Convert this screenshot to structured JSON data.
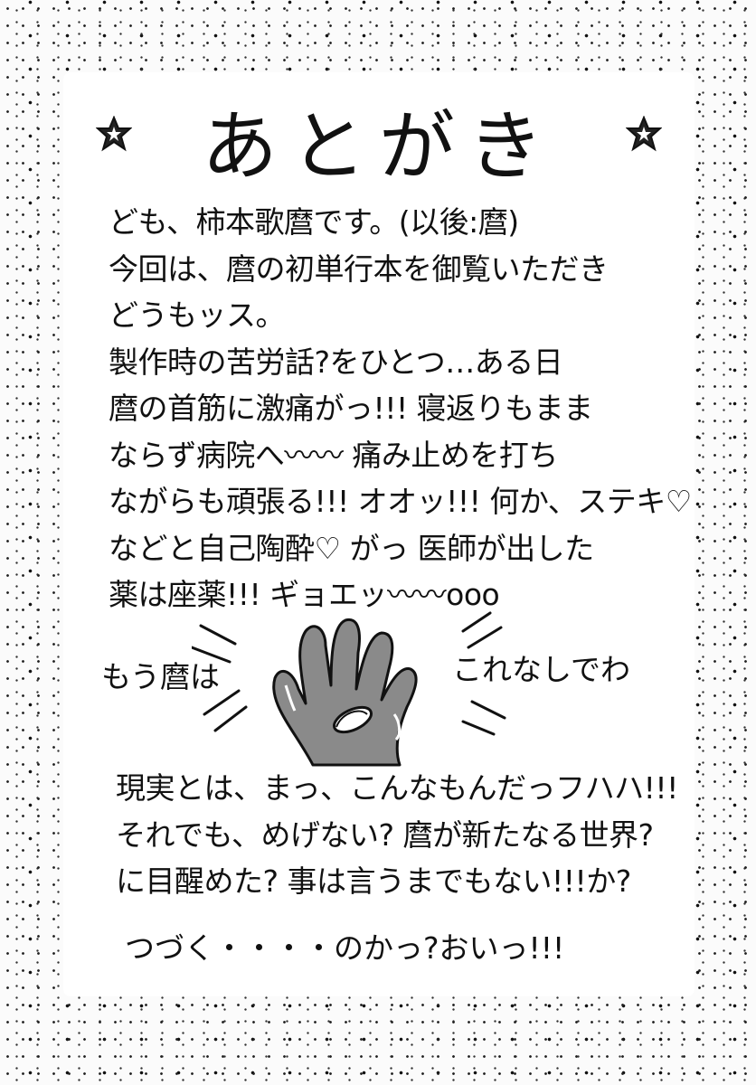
{
  "title": "あとがき",
  "body_lines": [
    "ども、柿本歌麿です。(以後:麿)",
    "今回は、麿の初単行本を御覧いただき",
    "どうもッス。",
    "製作時の苦労話?をひとつ…ある日",
    "麿の首筋に激痛がっ!!! 寝返りもまま",
    "ならず病院へ〰〰 痛み止めを打ち",
    "ながらも頑張る!!! オオッ!!! 何か、ステキ♡",
    "などと自己陶酔♡ がっ 医師が出した",
    "薬は座薬!!! ギョエッ〰〰ooo"
  ],
  "illustration": {
    "label_left": "もう麿は",
    "label_right": "これなしでわ"
  },
  "bottom_lines": [
    "現実とは、まっ、こんなもんだっフハハ!!!",
    "それでも、めげない? 麿が新たなる世界?",
    "に目醒めた? 事は言うまでもない!!!か?"
  ],
  "closing": "つづく・・・・のかっ?おいっ!!!",
  "colors": {
    "ink": "#111111",
    "hand_fill": "#8a8a8a",
    "paper": "#ffffff"
  }
}
